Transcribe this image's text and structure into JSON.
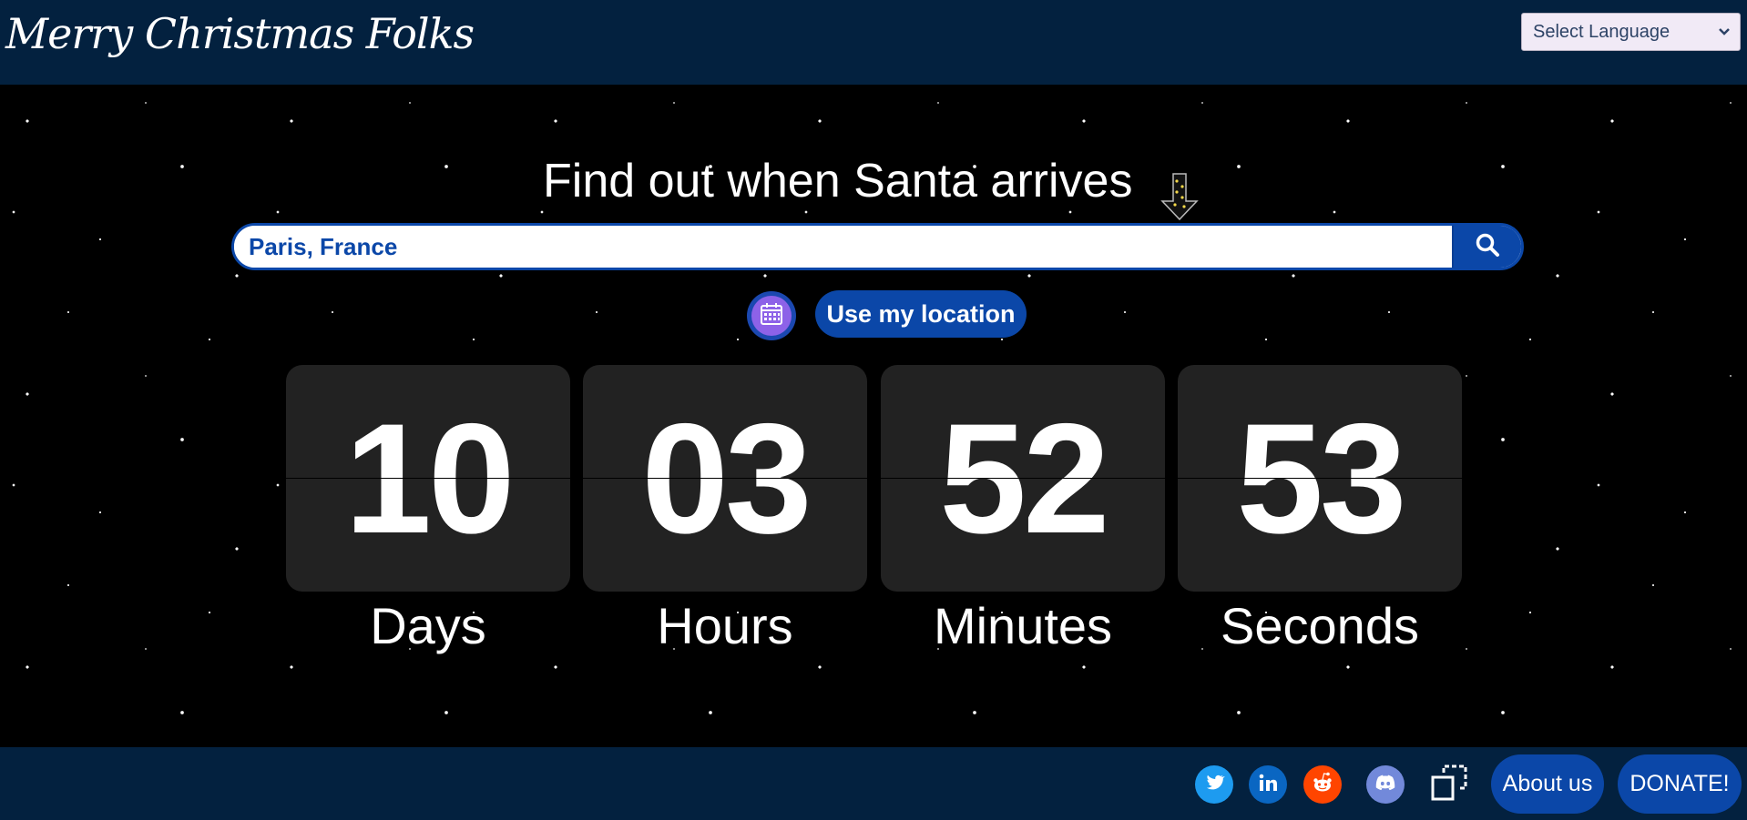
{
  "header": {
    "brand": "Merry Christmas Folks",
    "language_select": {
      "value": "Select Language"
    }
  },
  "main": {
    "headline": "Find out when Santa arrives",
    "search": {
      "value": "Paris, France"
    },
    "use_location_label": "Use my location",
    "countdown": [
      {
        "value": "10",
        "unit": "Days"
      },
      {
        "value": "03",
        "unit": "Hours"
      },
      {
        "value": "52",
        "unit": "Minutes"
      },
      {
        "value": "53",
        "unit": "Seconds"
      }
    ]
  },
  "footer": {
    "social": [
      "twitter-icon",
      "linkedin-icon",
      "reddit-icon",
      "discord-icon",
      "share-icon"
    ],
    "about_label": "About us",
    "donate_label": "DONATE!"
  },
  "colors": {
    "navy": "#03213f",
    "primary_blue": "#0b47a8",
    "tile": "#222222"
  }
}
